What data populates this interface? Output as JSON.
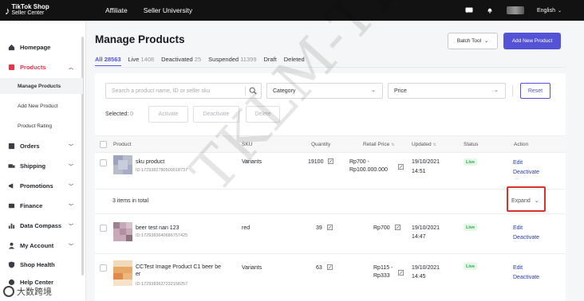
{
  "topbar": {
    "logo_line1": "TikTok Shop",
    "logo_line2": "Seller Center",
    "nav": [
      "Affiliate",
      "Seller University"
    ],
    "language": "English"
  },
  "sidebar": {
    "items": [
      {
        "label": "Homepage",
        "icon": "home-icon"
      },
      {
        "label": "Products",
        "icon": "box-icon",
        "active": true
      },
      {
        "label": "Orders",
        "icon": "list-icon"
      },
      {
        "label": "Shipping",
        "icon": "truck-icon"
      },
      {
        "label": "Promotions",
        "icon": "megaphone-icon"
      },
      {
        "label": "Finance",
        "icon": "wallet-icon"
      },
      {
        "label": "Data Compass",
        "icon": "chart-icon"
      },
      {
        "label": "My Account",
        "icon": "user-icon"
      },
      {
        "label": "Shop Health",
        "icon": "shield-icon"
      },
      {
        "label": "Help Center",
        "icon": "help-icon"
      }
    ],
    "sub_items": [
      "Manage Products",
      "Add New Product",
      "Product Rating"
    ]
  },
  "page": {
    "title": "Manage Products",
    "batch_tool": "Batch Tool",
    "add_new": "Add New Product"
  },
  "tabs": [
    {
      "label": "All",
      "count": "28563",
      "active": true
    },
    {
      "label": "Live",
      "count": "1408"
    },
    {
      "label": "Deactivated",
      "count": "25"
    },
    {
      "label": "Suspended",
      "count": "11399"
    },
    {
      "label": "Draft",
      "count": ""
    },
    {
      "label": "Deleted",
      "count": ""
    }
  ],
  "filters": {
    "search_placeholder": "Search a product name, ID or seller sku",
    "category": "Category",
    "price": "Price",
    "reset": "Reset"
  },
  "bulk": {
    "selected_label": "Selected:",
    "selected_count": "0",
    "activate": "Activate",
    "deactivate": "Deactivate",
    "delete": "Delete"
  },
  "table": {
    "headers": {
      "product": "Product",
      "sku": "SKU",
      "quantity": "Quantity",
      "retail_price": "Retail Price",
      "updated": "Updated",
      "status": "Status",
      "action": "Action"
    },
    "rows": [
      {
        "name": "sku product",
        "id": "ID:1729382780500018737",
        "sku": "Variants",
        "quantity": "19100",
        "price": "Rp700 -\nRp100.000.000",
        "updated_date": "19/10/2021",
        "updated_time": "14:51",
        "status": "Live",
        "edit": "Edit",
        "deactivate": "Deactivate",
        "more": "..."
      },
      {
        "name": "beer test nan 123",
        "id": "ID:1729383640686757425",
        "sku": "red",
        "quantity": "39",
        "price": "Rp700",
        "updated_date": "19/10/2021",
        "updated_time": "14:47",
        "status": "Live",
        "edit": "Edit",
        "deactivate": "Deactivate"
      },
      {
        "name": "CCTest Image Product C1 beer be\ner",
        "id": "ID:1729383637232158257",
        "sku": "Variants",
        "quantity": "63",
        "price": "Rp115 -\nRp333",
        "updated_date": "19/10/2021",
        "updated_time": "14:45",
        "status": "Live",
        "edit": "Edit",
        "deactivate": "Deactivate"
      }
    ],
    "items_total": "3 items in total",
    "expand": "Expand"
  },
  "watermark": "TKLM-TK成",
  "corner_brand": "大数跨境",
  "colors": {
    "accent": "#5453d6",
    "brand_red": "#e8354a",
    "live_green": "#2ea84c",
    "highlight": "#d9312b"
  }
}
